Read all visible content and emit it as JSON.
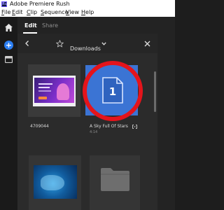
{
  "window": {
    "title": "Adobe Premiere Rush",
    "logo_text": "Ru"
  },
  "menu": {
    "items": [
      {
        "first": "F",
        "rest": "ile"
      },
      {
        "first": "E",
        "rest": "dit"
      },
      {
        "first": "C",
        "rest": "lip"
      },
      {
        "first": "S",
        "rest": "equence"
      },
      {
        "first": "V",
        "rest": "iew"
      },
      {
        "first": "H",
        "rest": "elp"
      }
    ]
  },
  "tabs": {
    "edit": "Edit",
    "share": "Share",
    "active": "Edit"
  },
  "browser": {
    "location": "Downloads",
    "icons": {
      "back": "chevron-left-icon",
      "favorite": "star-icon",
      "dropdown": "chevron-down-icon",
      "close": "close-icon"
    }
  },
  "media": {
    "items": [
      {
        "name": "4709044",
        "kind": "image"
      },
      {
        "name": "A Sky Full Of Stars",
        "duration": "4:14",
        "kind": "audio",
        "badge": "1"
      },
      {
        "kind": "image"
      },
      {
        "kind": "folder"
      }
    ]
  },
  "annotation": {
    "highlight_color": "#e4141b"
  },
  "colors": {
    "accent": "#2c7ff3",
    "audio_tile": "#3b74d4"
  }
}
